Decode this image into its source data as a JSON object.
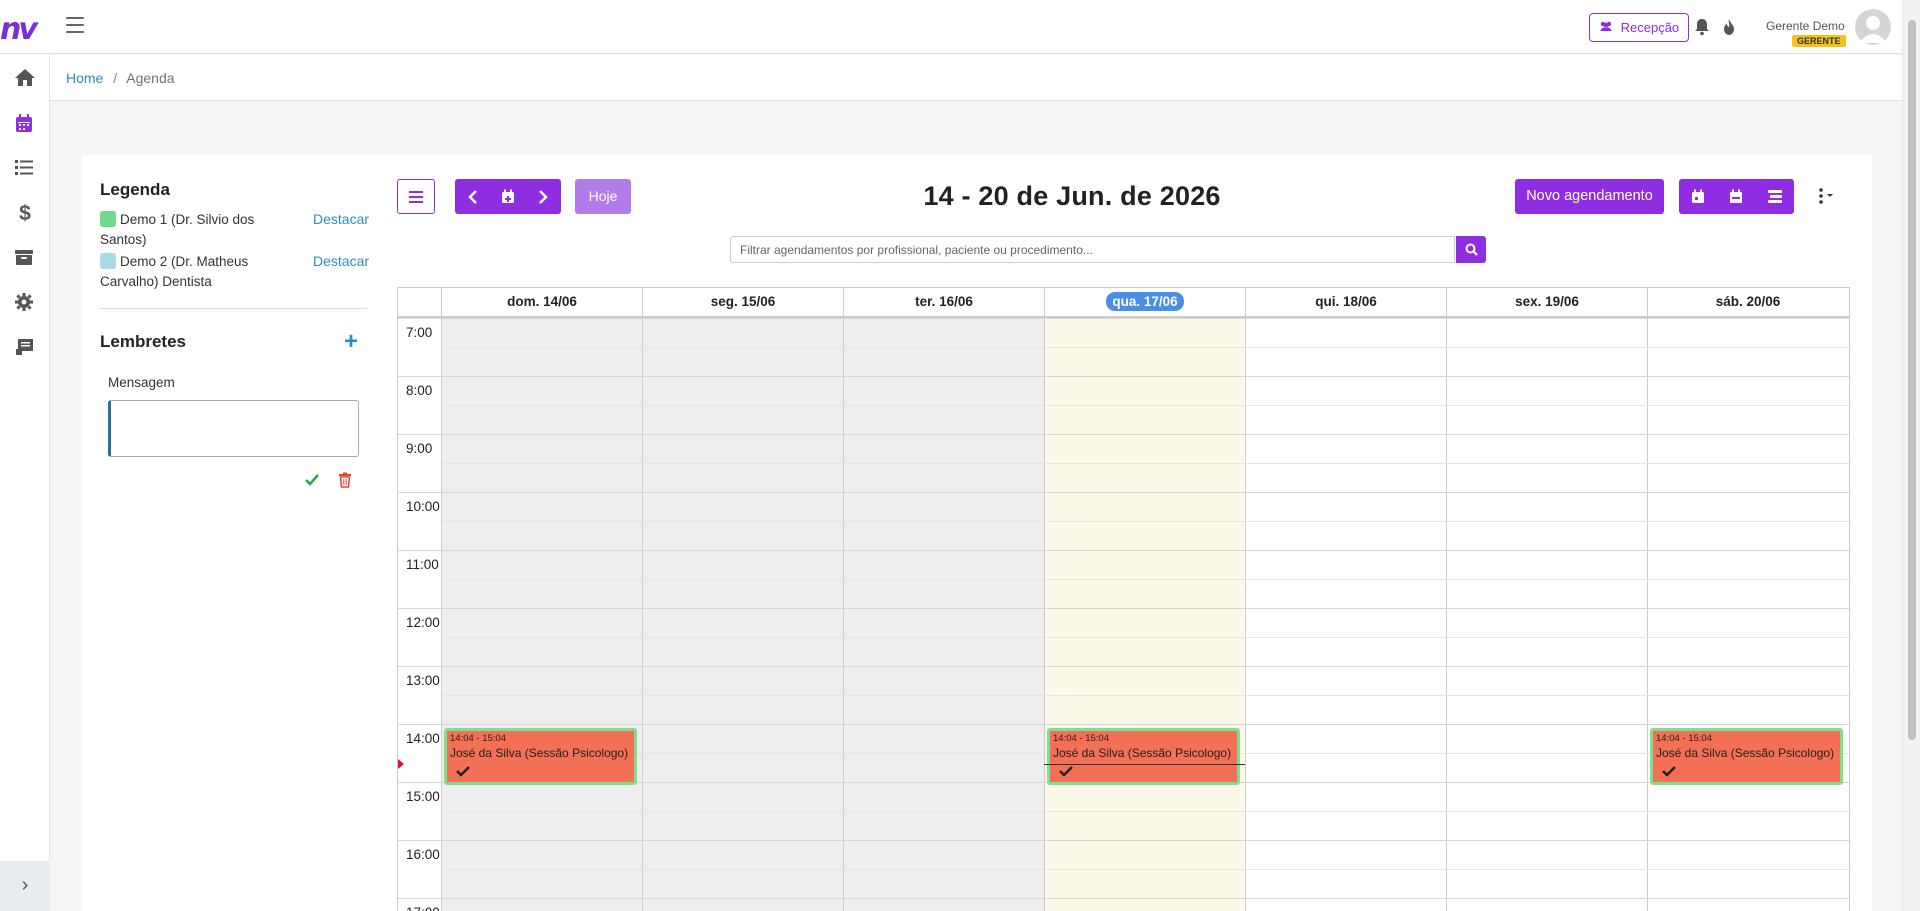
{
  "app": {
    "logo": "nv"
  },
  "header": {
    "recepcao_label": "Recepção",
    "user_name": "Gerente Demo",
    "user_role": "GERENTE"
  },
  "breadcrumb": {
    "home": "Home",
    "separator": "/",
    "current": "Agenda"
  },
  "legend": {
    "title": "Legenda",
    "items": [
      {
        "label": "Demo 1 (Dr. Silvio dos Santos)",
        "color": "#6fd88a",
        "action": "Destacar"
      },
      {
        "label": "Demo 2 (Dr. Matheus Carvalho) Dentista",
        "color": "#a9dbe6",
        "action": "Destacar"
      }
    ]
  },
  "reminders": {
    "title": "Lembretes",
    "add_icon": "plus-icon",
    "message_label": "Mensagem",
    "message_value": ""
  },
  "toolbar": {
    "today_label": "Hoje",
    "week_title": "14 - 20 de Jun. de 2026",
    "new_label": "Novo agendamento"
  },
  "search": {
    "placeholder": "Filtrar agendamentos por profissional, paciente ou procedimento..."
  },
  "calendar": {
    "days": [
      {
        "label": "dom. 14/06",
        "shaded": true,
        "today": false
      },
      {
        "label": "seg. 15/06",
        "shaded": true,
        "today": false
      },
      {
        "label": "ter. 16/06",
        "shaded": true,
        "today": false
      },
      {
        "label": "qua. 17/06",
        "shaded": false,
        "today": true
      },
      {
        "label": "qui. 18/06",
        "shaded": false,
        "today": false
      },
      {
        "label": "sex. 19/06",
        "shaded": false,
        "today": false
      },
      {
        "label": "sáb. 20/06",
        "shaded": false,
        "today": false
      }
    ],
    "hours": [
      "7:00",
      "8:00",
      "9:00",
      "10:00",
      "11:00",
      "12:00",
      "13:00",
      "14:00",
      "15:00",
      "16:00",
      "17:00"
    ],
    "events": [
      {
        "day": 0,
        "time": "14:04 - 15:04",
        "title": "José da Silva (Sessão Psicologo)"
      },
      {
        "day": 3,
        "time": "14:04 - 15:04",
        "title": "José da Silva (Sessão Psicologo)"
      },
      {
        "day": 6,
        "time": "14:04 - 15:04",
        "title": "José da Silva (Sessão Psicologo)"
      }
    ],
    "colors": {
      "shaded": "#eeeeee",
      "today": "#fcf9e8",
      "event": "#f36f55",
      "event_border": "#7ee08d"
    }
  }
}
